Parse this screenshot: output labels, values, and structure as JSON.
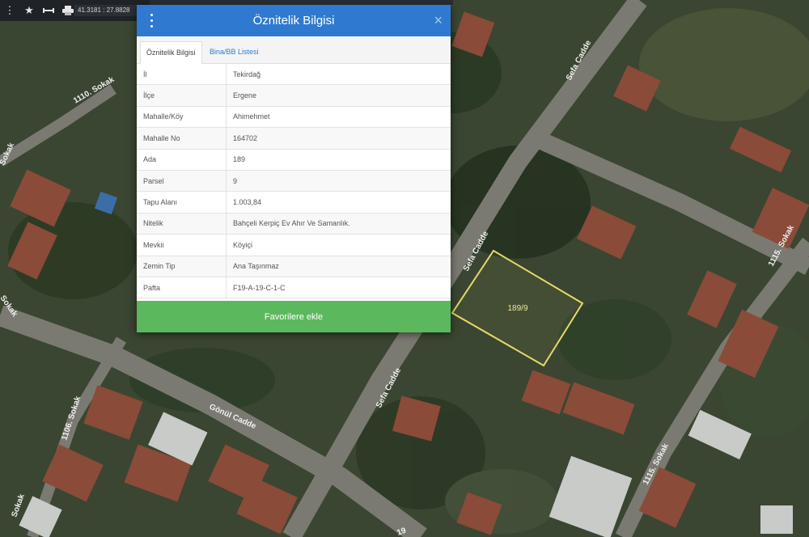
{
  "toolbar": {
    "icons": [
      "dots-icon",
      "star-icon",
      "ruler-icon",
      "print-icon"
    ],
    "coordinates": "41.3181 : 27.8828"
  },
  "panel": {
    "title": "Öznitelik Bilgisi",
    "close": "×",
    "tabs": [
      {
        "label": "Öznitelik Bilgisi",
        "active": true
      },
      {
        "label": "Bina/BB Listesi",
        "active": false
      }
    ],
    "rows": [
      {
        "key": "İl",
        "value": "Tekirdağ"
      },
      {
        "key": "İlçe",
        "value": "Ergene"
      },
      {
        "key": "Mahalle/Köy",
        "value": "Ahimehmet"
      },
      {
        "key": "Mahalle No",
        "value": "164702"
      },
      {
        "key": "Ada",
        "value": "189"
      },
      {
        "key": "Parsel",
        "value": "9"
      },
      {
        "key": "Tapu Alanı",
        "value": "1.003,84"
      },
      {
        "key": "Nitelik",
        "value": "Bahçeli Kerpiç Ev Ahır Ve Samanlık."
      },
      {
        "key": "Mevkii",
        "value": "Köyiçi"
      },
      {
        "key": "Zemin Tip",
        "value": "Ana Taşınmaz"
      },
      {
        "key": "Pafta",
        "value": "F19-A-19-C-1-C"
      }
    ],
    "button_label": "Favorilere ekle"
  },
  "map": {
    "parcel_label": "189/9",
    "street_labels": [
      "Sefa Cadde",
      "Sefa Cadde",
      "Sefa Cadde",
      "1110. Sokak",
      "Sokak",
      "1115. Sokak",
      "1115. Sokak",
      "Gönül Cadde",
      "1106. Sokak",
      "Sokak",
      "Sokak",
      "19"
    ],
    "colors": {
      "parcel_outline": "#e7d86a",
      "panel_header": "#2f7ad0",
      "button": "#5cb85c"
    }
  }
}
